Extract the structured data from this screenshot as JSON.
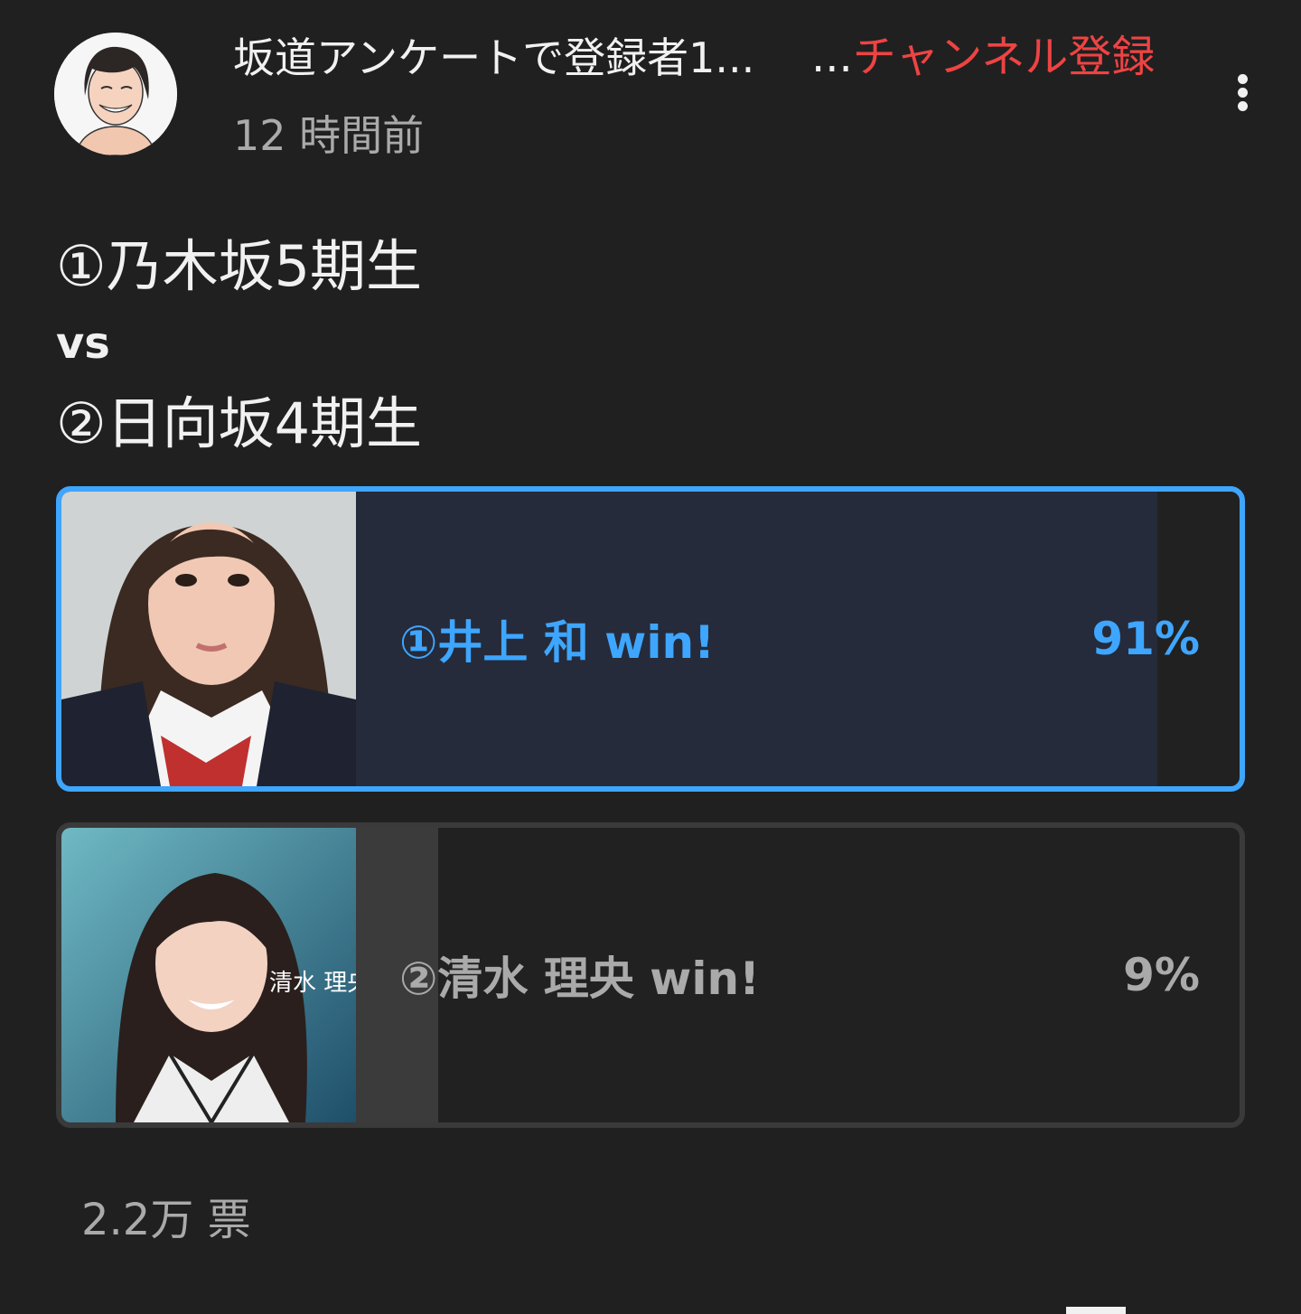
{
  "header": {
    "channel_name": "坂道アンケートで登録者1...",
    "subscribe_prefix": "...",
    "subscribe_label": "チャンネル登録",
    "timestamp": "12 時間前",
    "avatar_icon": "avatar-icon",
    "menu_icon": "more-vert-icon"
  },
  "post": {
    "line1": "①乃木坂5期生",
    "line2": "vs",
    "line3": "②日向坂4期生"
  },
  "poll": {
    "options": [
      {
        "label": "①井上 和 win!",
        "percent": "91%",
        "value": 91,
        "selected": true
      },
      {
        "label": "②清水 理央 win!",
        "percent": "9%",
        "value": 9,
        "selected": false
      }
    ],
    "image_caption": "清水 理央",
    "votes": "2.2万 票"
  },
  "colors": {
    "accent": "#3ea6ff",
    "subscribe": "#ef4343",
    "background": "#202020"
  }
}
